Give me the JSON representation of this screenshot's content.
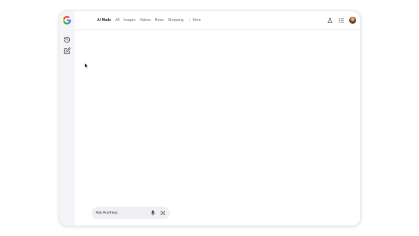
{
  "tabs": [
    {
      "label": "AI Mode",
      "active": true
    },
    {
      "label": "All",
      "active": false
    },
    {
      "label": "Images",
      "active": false
    },
    {
      "label": "Videos",
      "active": false
    },
    {
      "label": "News",
      "active": false
    },
    {
      "label": "Shopping",
      "active": false
    },
    {
      "label": "More",
      "active": false,
      "icon": "more-vert-icon"
    }
  ],
  "sidebar": {
    "icons": [
      "history-icon",
      "new-chat-icon"
    ]
  },
  "header_right": {
    "icons": [
      "labs-flask-icon",
      "apps-grid-icon",
      "avatar"
    ]
  },
  "search": {
    "placeholder": "Ask Anything",
    "icons": [
      "mic-icon",
      "lens-icon"
    ]
  },
  "colors": {
    "sidebar_bg": "#f3f5f8",
    "search_bg": "#eef0f4",
    "active_tab": "#202124",
    "tab_text": "#5f6368"
  }
}
